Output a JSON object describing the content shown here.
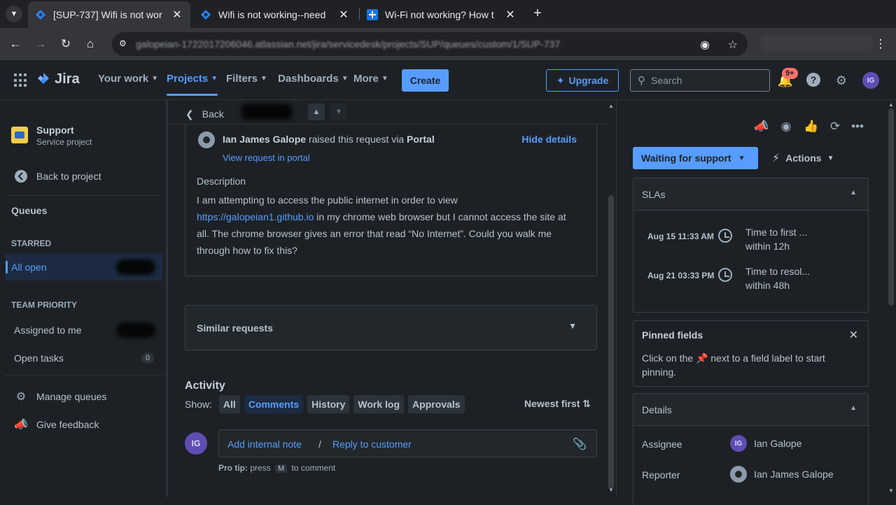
{
  "browser": {
    "tabs": [
      {
        "title": "[SUP-737] Wifi is not wor",
        "active": true
      },
      {
        "title": "Wifi is not working--need",
        "active": false
      },
      {
        "title": "Wi-Fi not working? How t",
        "active": false
      }
    ],
    "url": "galopeian-1722017206046.atlassian.net/jira/servicedesk/projects/SUP/queues/custom/1/SUP-737"
  },
  "topnav": {
    "logo": "Jira",
    "items": [
      "Your work",
      "Projects",
      "Filters",
      "Dashboards",
      "More"
    ],
    "active_item": "Projects",
    "create": "Create",
    "upgrade": "Upgrade",
    "search_placeholder": "Search",
    "notification_count": "9+",
    "avatar_initials": "IG"
  },
  "sidebar": {
    "project_name": "Support",
    "project_type": "Service project",
    "back_to_project": "Back to project",
    "queues": "Queues",
    "starred_heading": "STARRED",
    "all_open": "All open",
    "team_priority_heading": "TEAM PRIORITY",
    "assigned_to_me": "Assigned to me",
    "open_tasks": "Open tasks",
    "open_tasks_count": "0",
    "manage_queues": "Manage queues",
    "give_feedback": "Give feedback"
  },
  "request": {
    "back": "Back",
    "reporter": "Ian James Galope",
    "raised_via_text": "raised this request via",
    "channel": "Portal",
    "view_in_portal": "View request in portal",
    "hide_details": "Hide details",
    "description_label": "Description",
    "description_before_link": "I am attempting to access the public internet in order to view",
    "description_link": "https://galopeian1.github.io",
    "description_after_link": "in my chrome web browser but I cannot access the site at all. The chrome browser gives an error that read “No Internet”. Could you walk me through how to fix this?"
  },
  "similar": {
    "title": "Similar requests"
  },
  "activity": {
    "heading": "Activity",
    "show_label": "Show:",
    "filters": [
      "All",
      "Comments",
      "History",
      "Work log",
      "Approvals"
    ],
    "active_filter": "Comments",
    "sort": "Newest first",
    "avatar_initials": "IG",
    "add_internal_note": "Add internal note",
    "separator": "/",
    "reply_to_customer": "Reply to customer",
    "protip_label": "Pro tip:",
    "protip_press": "press",
    "protip_key": "M",
    "protip_rest": "to comment"
  },
  "rightpanel": {
    "status": "Waiting for support",
    "actions": "Actions",
    "slas_heading": "SLAs",
    "slas": [
      {
        "date": "Aug 15 11:33 AM",
        "name": "Time to first ...",
        "within": "within 12h"
      },
      {
        "date": "Aug 21 03:33 PM",
        "name": "Time to resol...",
        "within": "within 48h"
      }
    ],
    "pinned_heading": "Pinned fields",
    "pinned_before": "Click on the",
    "pinned_after": "next to a field label to start pinning.",
    "details_heading": "Details",
    "assignee_label": "Assignee",
    "assignee_initials": "IG",
    "assignee_name": "Ian Galope",
    "reporter_label": "Reporter",
    "reporter_name": "Ian James Galope"
  },
  "colors": {
    "accent": "#579dff",
    "background": "#1d2125",
    "badge": "#f87168"
  }
}
